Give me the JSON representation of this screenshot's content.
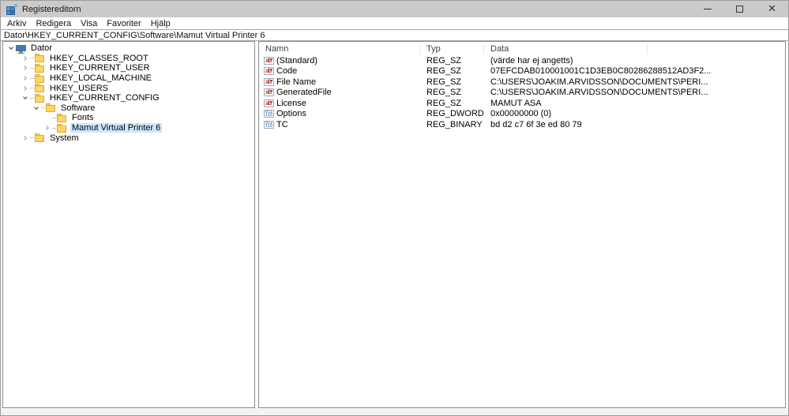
{
  "window": {
    "title": "Registereditorn",
    "controls": {
      "minimize": "minimize",
      "maximize": "maximize",
      "close": "close"
    }
  },
  "menubar": {
    "items": [
      "Arkiv",
      "Redigera",
      "Visa",
      "Favoriter",
      "Hjälp"
    ]
  },
  "addressbar": {
    "value": "Dator\\HKEY_CURRENT_CONFIG\\Software\\Mamut Virtual Printer 6"
  },
  "tree": {
    "items": [
      {
        "label": "Dator",
        "level": 0,
        "expander": "expanded",
        "icon": "computer",
        "selected": false
      },
      {
        "label": "HKEY_CLASSES_ROOT",
        "level": 1,
        "expander": "collapsed",
        "icon": "folder",
        "selected": false
      },
      {
        "label": "HKEY_CURRENT_USER",
        "level": 1,
        "expander": "collapsed",
        "icon": "folder",
        "selected": false
      },
      {
        "label": "HKEY_LOCAL_MACHINE",
        "level": 1,
        "expander": "collapsed",
        "icon": "folder",
        "selected": false
      },
      {
        "label": "HKEY_USERS",
        "level": 1,
        "expander": "collapsed",
        "icon": "folder",
        "selected": false
      },
      {
        "label": "HKEY_CURRENT_CONFIG",
        "level": 1,
        "expander": "expanded",
        "icon": "folder",
        "selected": false
      },
      {
        "label": "Software",
        "level": 2,
        "expander": "expanded",
        "icon": "folder",
        "selected": false
      },
      {
        "label": "Fonts",
        "level": 3,
        "expander": "none",
        "icon": "folder",
        "selected": false
      },
      {
        "label": "Mamut Virtual Printer 6",
        "level": 3,
        "expander": "collapsed",
        "icon": "folder",
        "selected": true
      },
      {
        "label": "System",
        "level": 1,
        "expander": "collapsed",
        "icon": "folder",
        "selected": false
      }
    ]
  },
  "list": {
    "columns": [
      "Namn",
      "Typ",
      "Data"
    ],
    "rows": [
      {
        "icon": "string",
        "name": "(Standard)",
        "type": "REG_SZ",
        "data": "(värde har ej angetts)"
      },
      {
        "icon": "string",
        "name": "Code",
        "type": "REG_SZ",
        "data": "07EFCDAB010001001C1D3EB0C80286288512AD3F2..."
      },
      {
        "icon": "string",
        "name": "File Name",
        "type": "REG_SZ",
        "data": "C:\\USERS\\JOAKIM.ARVIDSSON\\DOCUMENTS\\PERI..."
      },
      {
        "icon": "string",
        "name": "GeneratedFile",
        "type": "REG_SZ",
        "data": "C:\\USERS\\JOAKIM.ARVIDSSON\\DOCUMENTS\\PERI..."
      },
      {
        "icon": "string",
        "name": "License",
        "type": "REG_SZ",
        "data": "MAMUT ASA"
      },
      {
        "icon": "binary",
        "name": "Options",
        "type": "REG_DWORD",
        "data": "0x00000000 (0)"
      },
      {
        "icon": "binary",
        "name": "TC",
        "type": "REG_BINARY",
        "data": "bd d2 c7 6f 3e ed 80 79"
      }
    ]
  },
  "colors": {
    "titlebar_bg": "#cbcbcb",
    "selection_bg": "#cce8ff",
    "folder_yellow": "#ffd661",
    "panel_border": "#8c8c8c",
    "string_icon_red": "#c53a2a",
    "binary_icon_blue": "#2b5fb4",
    "computer_screen_blue": "#3a79c3"
  }
}
